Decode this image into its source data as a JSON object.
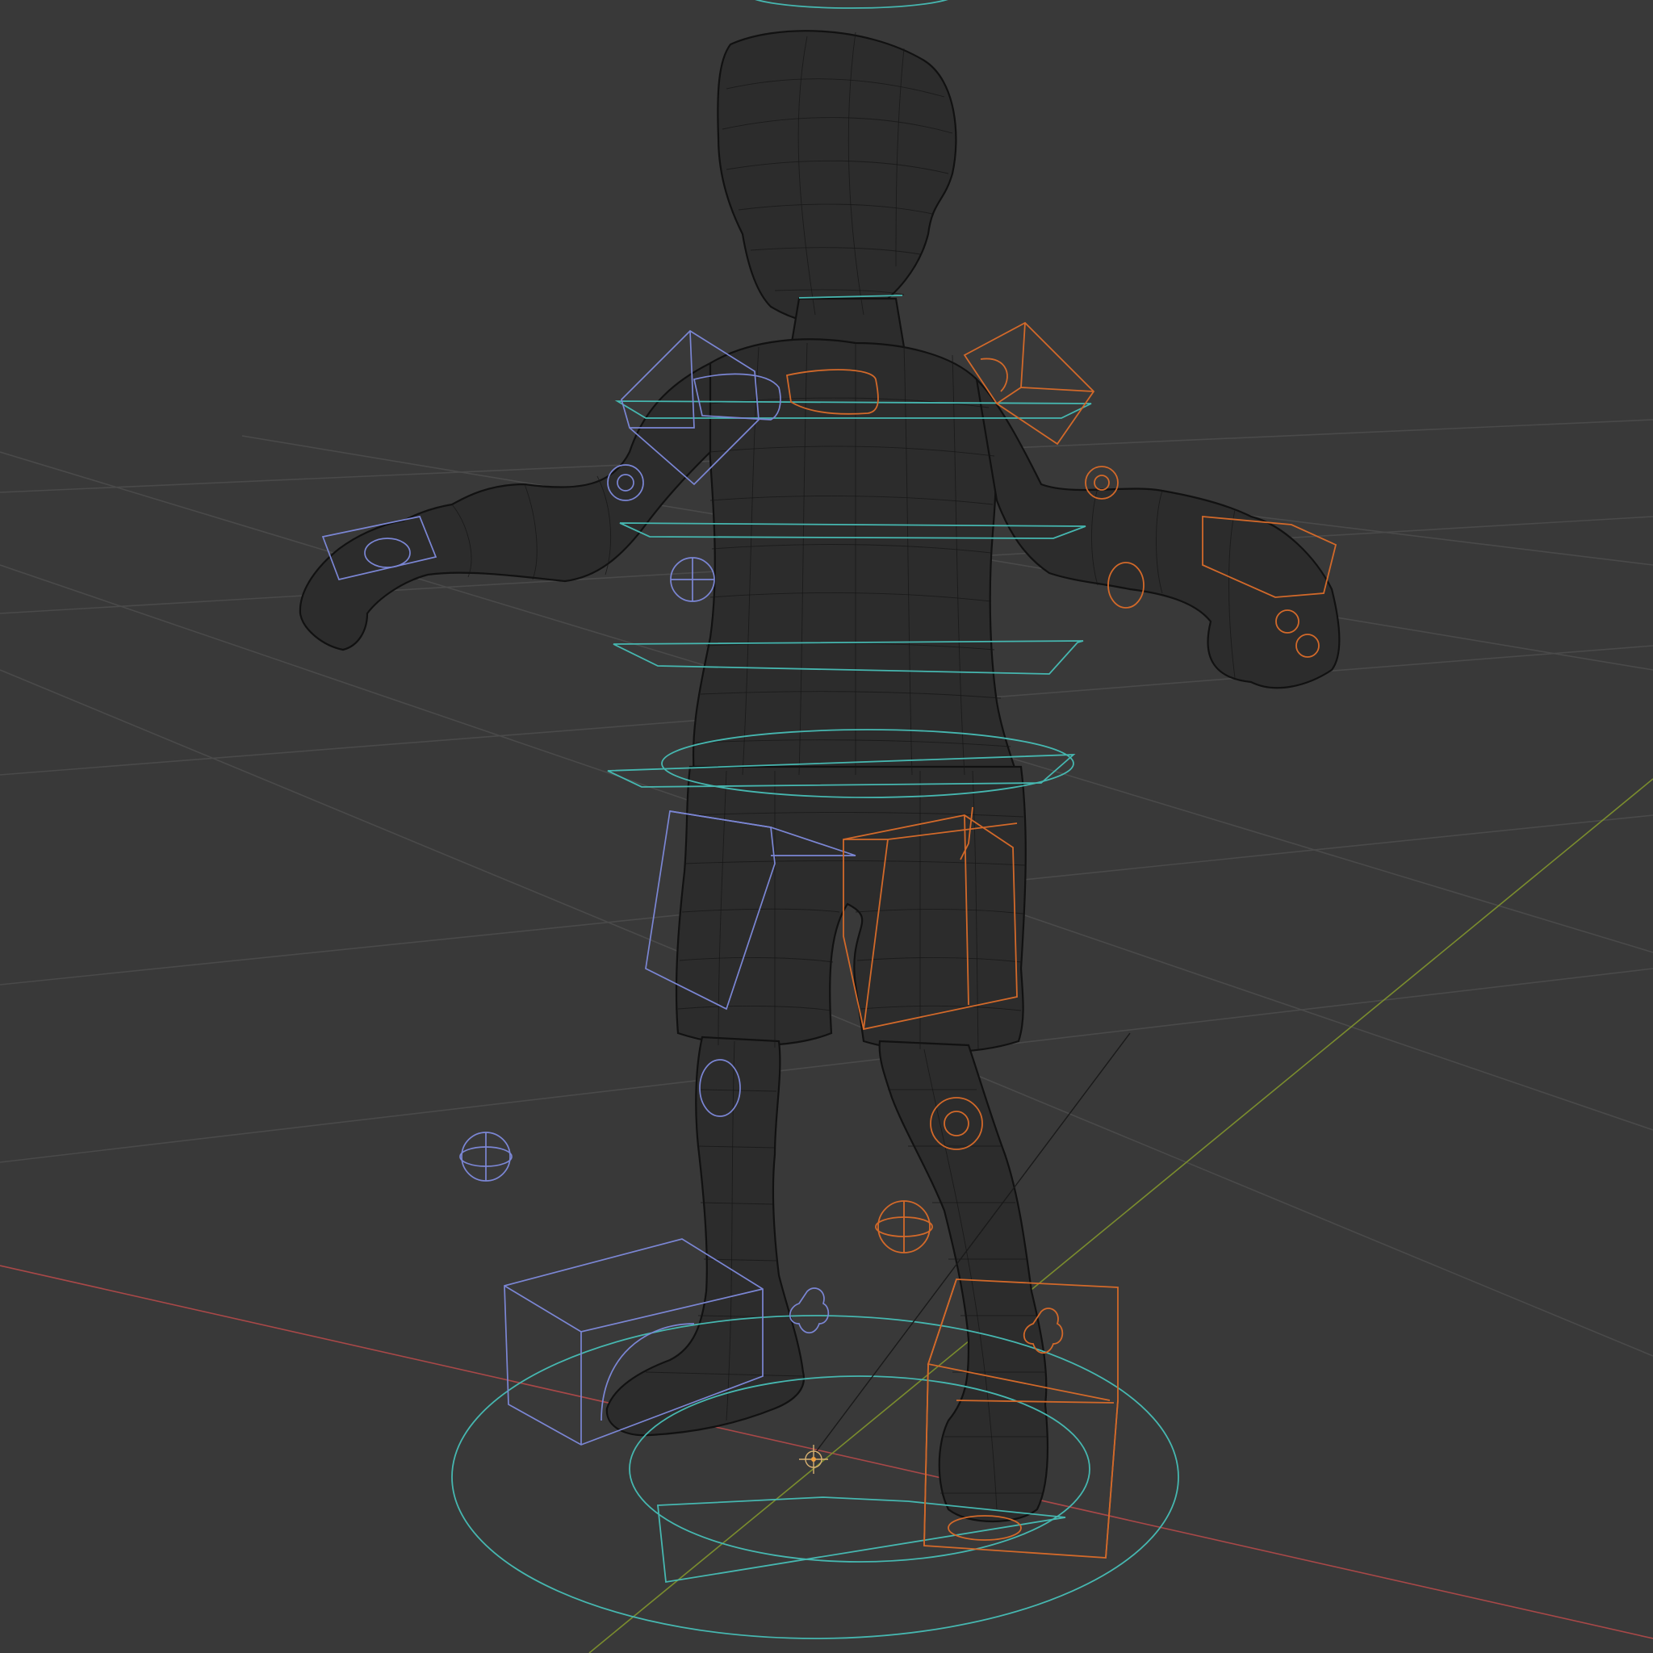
{
  "viewport": {
    "mode": "wireframe",
    "background": "#393939",
    "colors": {
      "grid": "#4a4a4a",
      "x_axis": "#a84848",
      "y_axis": "#7a8c2e",
      "mesh_wire": "#151515",
      "center_controls": "#46b7b0",
      "left_controls": "#7b86d4",
      "right_controls": "#d2692a",
      "origin": "#e0a050"
    },
    "icons": {
      "origin": "3d-cursor-icon",
      "hint_target_left": "sphere-gizmo-icon",
      "hint_target_right": "sphere-gizmo-icon"
    }
  }
}
